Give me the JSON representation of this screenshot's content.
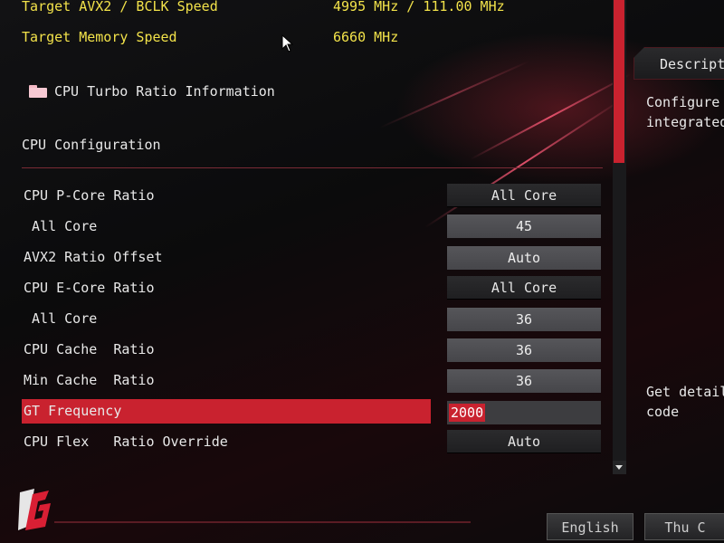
{
  "header": {
    "avx2_label": "Target AVX2 / BCLK Speed",
    "avx2_value": "4995 MHz / 111.00 MHz",
    "memory_label": "Target Memory Speed",
    "memory_value": "6660 MHz"
  },
  "folder_item": {
    "label": "CPU Turbo Ratio Information"
  },
  "section": {
    "title": "CPU Configuration"
  },
  "settings": [
    {
      "label": "CPU P-Core Ratio",
      "value": "All Core"
    },
    {
      "label": " All Core",
      "value": "45"
    },
    {
      "label": "AVX2 Ratio Offset",
      "value": "Auto"
    },
    {
      "label": "CPU E-Core Ratio",
      "value": "All Core"
    },
    {
      "label": " All Core",
      "value": "36"
    },
    {
      "label": "CPU Cache  Ratio",
      "value": "36"
    },
    {
      "label": "Min Cache  Ratio",
      "value": "36"
    },
    {
      "label": "GT Frequency",
      "value": "2000"
    },
    {
      "label": "CPU Flex   Ratio Override",
      "value": "Auto"
    }
  ],
  "description": {
    "header": "Descripti",
    "line1": "Configure t",
    "line2": "integrated",
    "line3": "Get details",
    "line4": "code"
  },
  "footer": {
    "language_button": "English",
    "date_button": "Thu C"
  },
  "colors": {
    "accent": "#c9222f",
    "highlight_text": "#f2e24a"
  },
  "icons": {
    "folder": "folder-icon",
    "logo": "phantom-gaming-logo",
    "cursor": "mouse-pointer-icon"
  }
}
